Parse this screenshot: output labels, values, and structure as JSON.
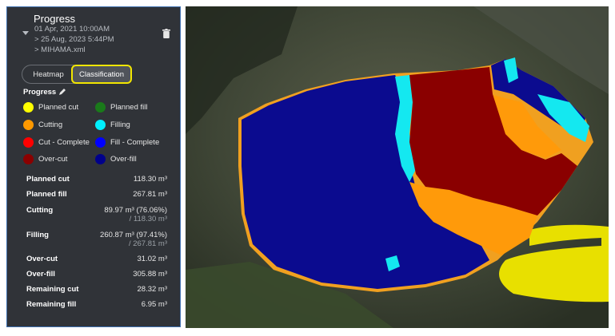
{
  "header": {
    "title": "Progress",
    "date_from": "01 Apr, 2021 10:00AM",
    "date_to": "> 25 Aug, 2023 5:44PM",
    "file": "> MIHAMA.xml"
  },
  "tabs": [
    {
      "label": "Heatmap",
      "active": false
    },
    {
      "label": "Classification",
      "active": true
    }
  ],
  "progress_label": "Progress",
  "legend": [
    {
      "label": "Planned cut",
      "color": "#ffff00"
    },
    {
      "label": "Planned fill",
      "color": "#1a7a1a"
    },
    {
      "label": "Cutting",
      "color": "#ff9900"
    },
    {
      "label": "Filling",
      "color": "#00f0ff"
    },
    {
      "label": "Cut - Complete",
      "color": "#ff0000"
    },
    {
      "label": "Fill - Complete",
      "color": "#0000ff"
    },
    {
      "label": "Over-cut",
      "color": "#8b0000"
    },
    {
      "label": "Over-fill",
      "color": "#00008b"
    }
  ],
  "stats": [
    {
      "label": "Planned cut",
      "value": "118.30 m³",
      "sub": ""
    },
    {
      "label": "Planned fill",
      "value": "267.81 m³",
      "sub": ""
    },
    {
      "label": "Cutting",
      "value": "89.97 m³ (76.06%)",
      "sub": "/ 118.30 m³"
    },
    {
      "label": "Filling",
      "value": "260.87 m³ (97.41%)",
      "sub": "/ 267.81 m³"
    },
    {
      "label": "Over-cut",
      "value": "31.02 m³",
      "sub": ""
    },
    {
      "label": "Over-fill",
      "value": "305.88 m³",
      "sub": ""
    },
    {
      "label": "Remaining cut",
      "value": "28.32 m³",
      "sub": ""
    },
    {
      "label": "Remaining fill",
      "value": "6.95 m³",
      "sub": ""
    }
  ]
}
